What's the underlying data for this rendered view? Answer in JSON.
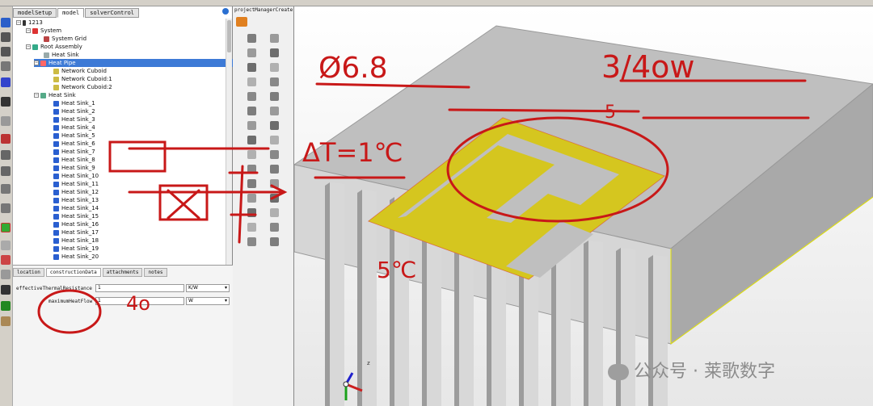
{
  "left_tabs": [
    "modelSetup",
    "model",
    "solverControl"
  ],
  "tree": {
    "root": "1213",
    "system": "System",
    "system_grid": "System Grid",
    "root_assembly": "Root Assembly",
    "heat_sink_a": "Heat Sink",
    "heat_pipe": "Heat Pipe",
    "cuboid0": "Network Cuboid",
    "cuboid1": "Network Cuboid:1",
    "cuboid2": "Network Cuboid:2",
    "heat_sink_b": "Heat Sink",
    "sinks": [
      "Heat Sink_1",
      "Heat Sink_2",
      "Heat Sink_3",
      "Heat Sink_4",
      "Heat Sink_5",
      "Heat Sink_6",
      "Heat Sink_7",
      "Heat Sink_8",
      "Heat Sink_9",
      "Heat Sink_10",
      "Heat Sink_11",
      "Heat Sink_12",
      "Heat Sink_13",
      "Heat Sink_14",
      "Heat Sink_15",
      "Heat Sink_16",
      "Heat Sink_17",
      "Heat Sink_18",
      "Heat Sink_19",
      "Heat Sink_20"
    ]
  },
  "props": {
    "tabs": [
      "location",
      "constructionData",
      "attachments",
      "notes"
    ],
    "row1_label": "effectiveThermalResistance",
    "row1_value": "1",
    "row1_unit": "K/W",
    "row2_label": "maximumHeatFlow",
    "row2_value": "1",
    "row2_unit": "W"
  },
  "project_manager_title": "projectManagerCreate",
  "handwriting": {
    "a": "Ø6.8",
    "b": "3/4ow",
    "c": "5",
    "d": "ΔT=1℃",
    "e": "5℃",
    "f": "4o"
  },
  "axes": {
    "z": "z"
  },
  "watermark": "公众号 · 莱歌数字",
  "colors": {
    "selection": "#3d7ad6",
    "pipe": "#c8c000",
    "ink": "#c81818"
  }
}
